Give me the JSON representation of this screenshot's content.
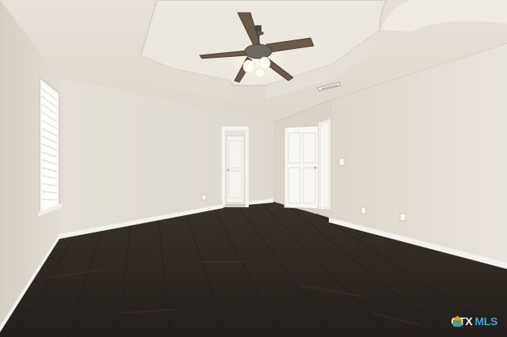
{
  "scene": {
    "description_label": "empty-bedroom-photo",
    "objects": [
      "ceiling-fan",
      "window-blinds",
      "open-doorway",
      "closed-door",
      "air-vent",
      "light-switch",
      "power-outlet",
      "hardwood-floor",
      "baseboards"
    ]
  },
  "watermark": {
    "brand_prefix": "CTX",
    "brand_suffix": "MLS",
    "icon": "house-flower-icon",
    "colors": {
      "prefix": "#ffffff",
      "suffix": "#3fa7e0",
      "icon_green": "#4caf50",
      "icon_orange": "#f39c12",
      "icon_blue": "#2f8fd8"
    }
  },
  "colors": {
    "wall_light": "#e7e2d9",
    "wall_shadow": "#cfc9be",
    "ceiling": "#ebe7df",
    "floor_dark": "#2c2520",
    "floor_mid": "#3b332c",
    "trim": "#f4f2ee",
    "fan_blade": "#6b5a4a"
  }
}
